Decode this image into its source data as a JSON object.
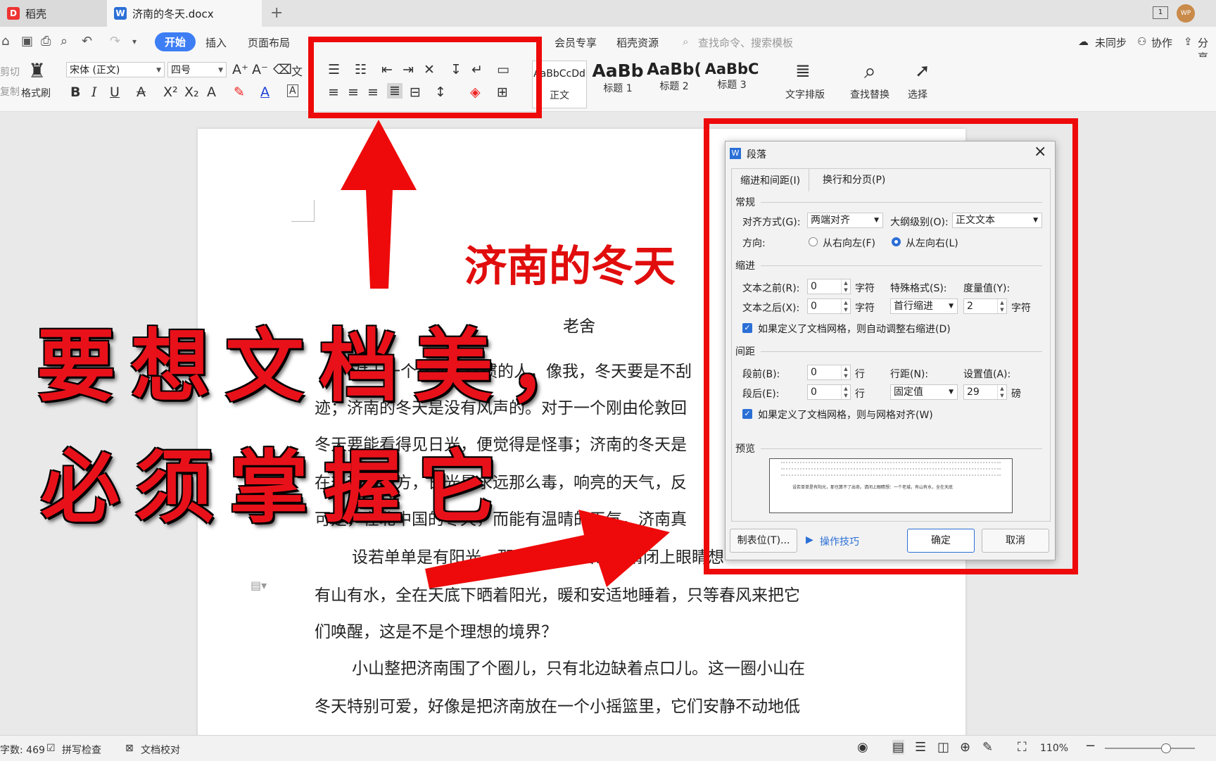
{
  "tabs": {
    "home": "稻壳",
    "doc": "济南的冬天.docx"
  },
  "menu": {
    "start": "开始",
    "insert": "插入",
    "layout": "页面布局",
    "vip": "会员专享",
    "resources": "稻壳资源",
    "search_placeholder": "查找命令、搜索模板",
    "sync": "未同步",
    "collab": "协作",
    "share": "分享"
  },
  "ribbon": {
    "cut": "剪切",
    "copy": "复制",
    "format_painter": "格式刷",
    "font": "宋体 (正文)",
    "size": "四号",
    "styles": [
      {
        "preview": "AaBbCcDd",
        "label": "正文"
      },
      {
        "preview": "AaBb",
        "label": "标题 1"
      },
      {
        "preview": "AaBb(",
        "label": "标题 2"
      },
      {
        "preview": "AaBbC",
        "label": "标题 3"
      }
    ],
    "text_layout": "文字排版",
    "find_replace": "查找替换",
    "select": "选择"
  },
  "document": {
    "title": "济南的冬天",
    "author": "老舍",
    "lines": [
      "对于一个在北平住惯的人，像我，冬天要是不刮",
      "迹；济南的冬天是没有风声的。对于一个刚由伦敦回",
      "冬天要能看得见日光，便觉得是怪事；济南的冬天是",
      "在热带的地方，日光是永远那么毒，响亮的天气，反",
      "可是，在北中国的冬天，而能有温晴的天气，济南真",
      "设若单单是有阳光，那也算不了出奇。请闭上眼睛想",
      "有山有水，全在天底下晒着阳光，暖和安适地睡着，只等春风来把它",
      "们唤醒，这是不是个理想的境界？",
      "小山整把济南围了个圈儿，只有北边缺着点口儿。这一圈小山在",
      "冬天特别可爱，好像是把济南放在一个小摇篮里，它们安静不动地低"
    ]
  },
  "overlay": {
    "line1": "要想文档美，",
    "line2": "必须掌握它"
  },
  "dialog": {
    "title": "段落",
    "tab1": "缩进和间距(I)",
    "tab2": "换行和分页(P)",
    "general": "常规",
    "align_label": "对齐方式(G):",
    "align_value": "两端对齐",
    "outline_label": "大纲级别(O):",
    "outline_value": "正文文本",
    "direction_label": "方向:",
    "rtl": "从右向左(F)",
    "ltr": "从左向右(L)",
    "indent": "缩进",
    "before_text": "文本之前(R):",
    "before_val": "0",
    "unit_char": "字符",
    "special_label": "特殊格式(S):",
    "measure_label": "度量值(Y):",
    "after_text": "文本之后(X):",
    "after_val": "0",
    "special_val": "首行缩进",
    "measure_val": "2",
    "auto_indent": "如果定义了文档网格，则自动调整右缩进(D)",
    "spacing": "间距",
    "space_before": "段前(B):",
    "space_before_val": "0",
    "unit_line": "行",
    "line_spacing_label": "行距(N):",
    "setting_label": "设置值(A):",
    "space_after": "段后(E):",
    "space_after_val": "0",
    "line_spacing_val": "固定值",
    "setting_val": "29",
    "unit_pt": "磅",
    "snap_grid": "如果定义了文档网格，则与网格对齐(W)",
    "preview": "预览",
    "preview_text": "设若单单是有阳光，那也算不了出奇。请闭上眼睛想：一个老城，有山有水，全在天底",
    "tabs_btn": "制表位(T)...",
    "tips": "操作技巧",
    "ok": "确定",
    "cancel": "取消"
  },
  "status": {
    "word_count": "字数: 469",
    "spell": "拼写检查",
    "proof": "文档校对",
    "zoom": "110%"
  }
}
